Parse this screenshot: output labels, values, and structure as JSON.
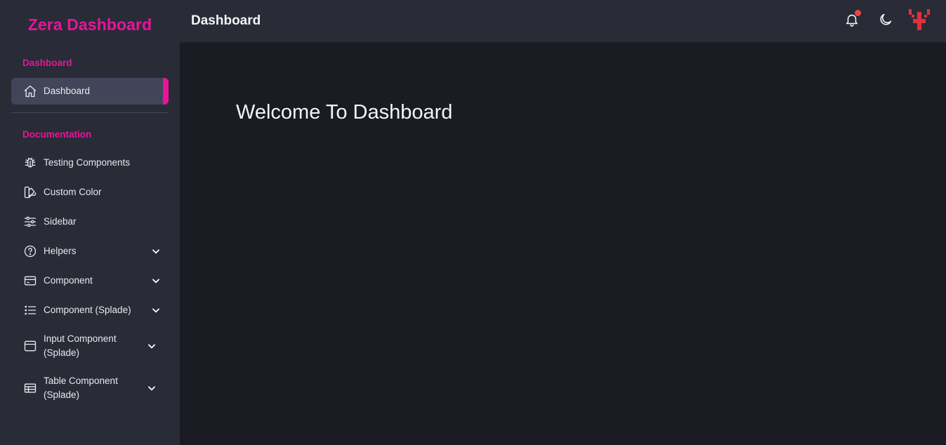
{
  "brand": {
    "title": "Zera Dashboard"
  },
  "sidebar": {
    "sections": [
      {
        "label": "Dashboard"
      },
      {
        "label": "Documentation"
      }
    ],
    "items": [
      {
        "label": "Dashboard",
        "icon": "home-icon",
        "active": true
      },
      {
        "label": "Testing Components",
        "icon": "bug-icon"
      },
      {
        "label": "Custom Color",
        "icon": "color-swatch-icon"
      },
      {
        "label": "Sidebar",
        "icon": "sliders-icon"
      },
      {
        "label": "Helpers",
        "icon": "help-circle-icon",
        "expandable": true
      },
      {
        "label": "Component",
        "icon": "credit-card-icon",
        "expandable": true
      },
      {
        "label": "Component (Splade)",
        "icon": "list-icon",
        "expandable": true
      },
      {
        "label": "Input Component (Splade)",
        "icon": "browser-window-icon",
        "expandable": true
      },
      {
        "label": "Table Component (Splade)",
        "icon": "table-icon",
        "expandable": true
      }
    ]
  },
  "header": {
    "title": "Dashboard",
    "icons": [
      "bell-icon",
      "moon-icon",
      "user-avatar-icon"
    ]
  },
  "main": {
    "heading": "Welcome To Dashboard"
  },
  "colors": {
    "accent": "#e9149a",
    "sidebar_bg": "#292b37",
    "main_bg": "#1a1b23",
    "notification": "#ef4444"
  }
}
